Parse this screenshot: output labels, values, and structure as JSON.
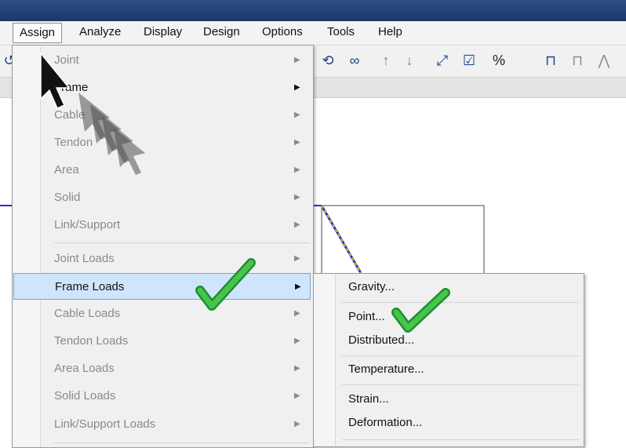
{
  "menu": {
    "items": [
      {
        "label": "Assign",
        "active": true
      },
      {
        "label": "Analyze"
      },
      {
        "label": "Display"
      },
      {
        "label": "Design"
      },
      {
        "label": "Options"
      },
      {
        "label": "Tools"
      },
      {
        "label": "Help"
      }
    ]
  },
  "toolbar": {
    "icons": [
      "link-icon",
      "glasses-icon",
      "arrow-up-icon",
      "arrow-down-icon",
      "fit-icon",
      "checkbox-icon",
      "percent-dropdown-icon",
      "frame-icon",
      "truss-icon",
      "gable-icon"
    ]
  },
  "assign_menu": {
    "items": [
      {
        "label": "Joint",
        "enabled": false
      },
      {
        "label": "Frame",
        "enabled": true
      },
      {
        "label": "Cable",
        "enabled": false
      },
      {
        "label": "Tendon",
        "enabled": false
      },
      {
        "label": "Area",
        "enabled": false
      },
      {
        "label": "Solid",
        "enabled": false
      },
      {
        "label": "Link/Support",
        "enabled": false
      },
      {
        "label": "Joint Loads",
        "enabled": false
      },
      {
        "label": "Frame Loads",
        "enabled": true,
        "hover": true
      },
      {
        "label": "Cable Loads",
        "enabled": false
      },
      {
        "label": "Tendon Loads",
        "enabled": false
      },
      {
        "label": "Area Loads",
        "enabled": false
      },
      {
        "label": "Solid Loads",
        "enabled": false
      },
      {
        "label": "Link/Support Loads",
        "enabled": false
      }
    ]
  },
  "frame_loads_submenu": {
    "items": [
      {
        "label": "Gravity..."
      },
      {
        "label": "Point..."
      },
      {
        "label": "Distributed..."
      },
      {
        "label": "Temperature..."
      },
      {
        "label": "Strain..."
      },
      {
        "label": "Deformation..."
      }
    ]
  },
  "colors": {
    "titlebar": "#1c3768",
    "hover_bg": "#cfe5fb",
    "checkmark": "#2ca63d",
    "frame_line": "#2b2bd6",
    "dashed_member": "#d7c300"
  }
}
